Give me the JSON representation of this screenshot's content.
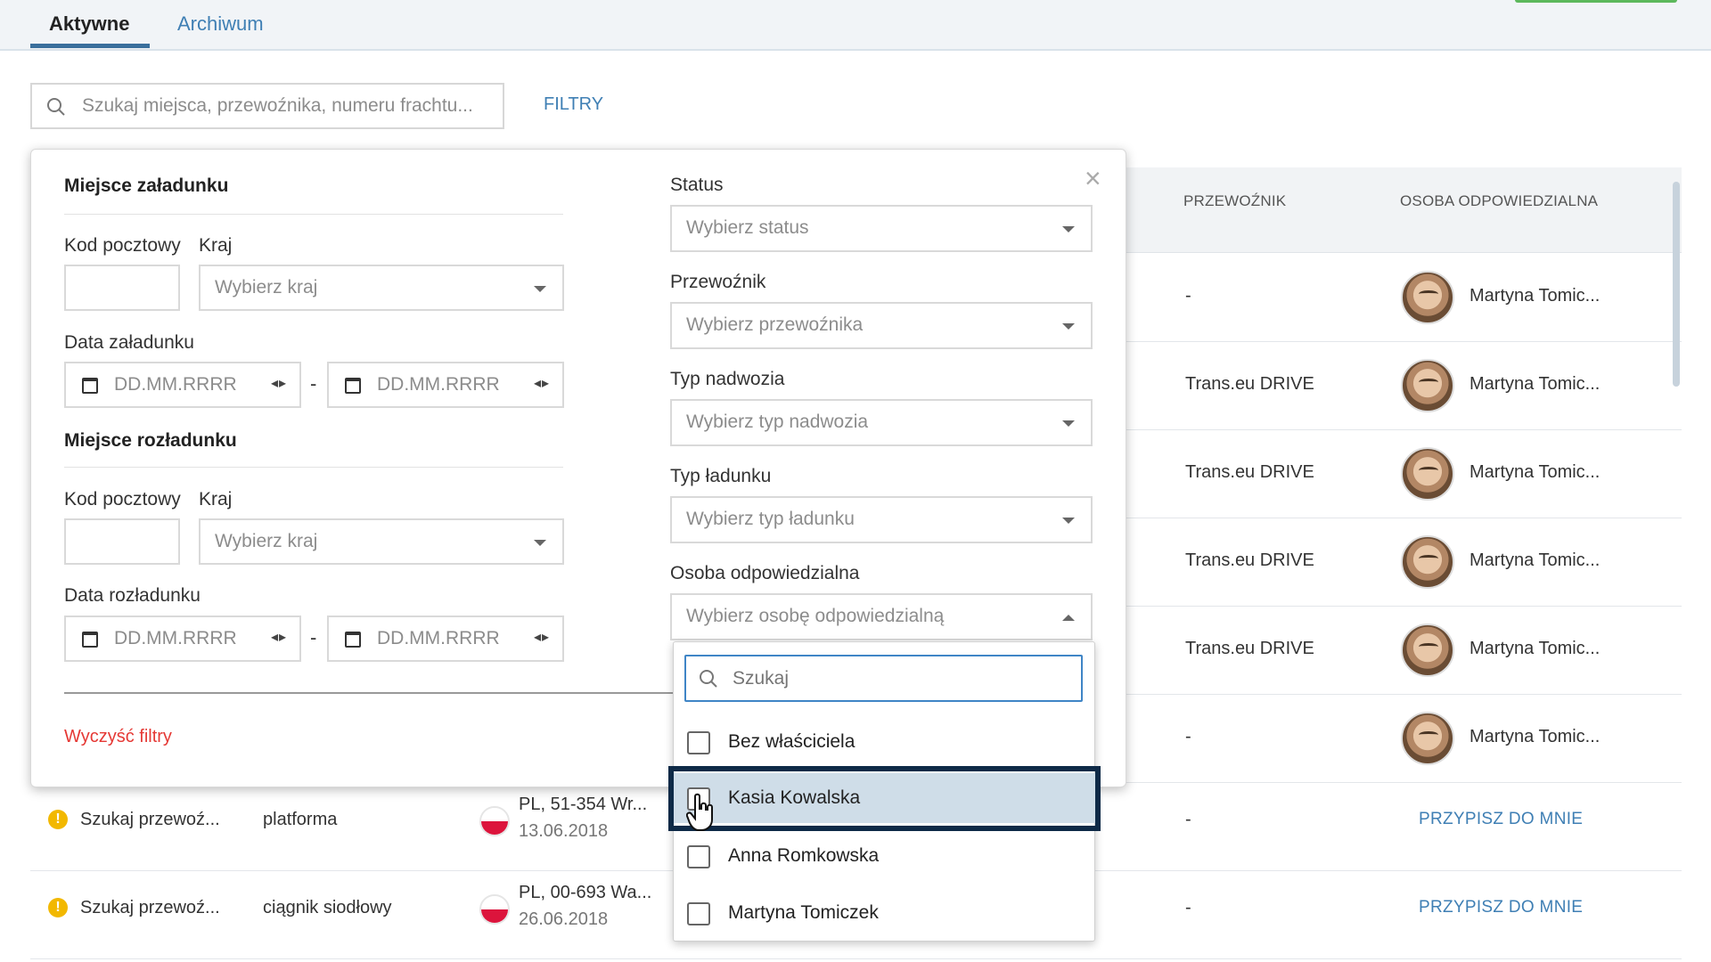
{
  "tabs": {
    "active": "Aktywne",
    "archive": "Archiwum"
  },
  "search": {
    "placeholder": "Szukaj miejsca, przewoźnika, numeru frachtu...",
    "filters_label": "FILTRY"
  },
  "table": {
    "headers": {
      "carrier": "PRZEWOŹNIK",
      "responsible": "OSOBA ODPOWIEDZIALNA"
    },
    "rows": [
      {
        "carrier": "-",
        "person": "Martyna Tomic..."
      },
      {
        "carrier": "Trans.eu DRIVE",
        "person": "Martyna Tomic..."
      },
      {
        "carrier": "Trans.eu DRIVE",
        "person": "Martyna Tomic..."
      },
      {
        "carrier": "Trans.eu DRIVE",
        "person": "Martyna Tomic..."
      },
      {
        "carrier": "Trans.eu DRIVE",
        "person": "Martyna Tomic..."
      },
      {
        "carrier": "-",
        "person": "Martyna Tomic..."
      },
      {
        "status": "Szukaj przewoź...",
        "body": "platforma",
        "place": "PL, 51-354 Wr...",
        "date": "13.06.2018",
        "carrier": "-",
        "assign": "PRZYPISZ DO MNIE"
      },
      {
        "status": "Szukaj przewoź...",
        "body": "ciągnik siodłowy",
        "place": "PL, 00-693 Wa...",
        "date": "26.06.2018",
        "carrier": "-",
        "assign": "PRZYPISZ DO MNIE"
      }
    ]
  },
  "filters": {
    "loading": {
      "title": "Miejsce załadunku",
      "postal_label": "Kod pocztowy",
      "country_label": "Kraj",
      "country_placeholder": "Wybierz kraj",
      "date_label": "Data załadunku",
      "date_placeholder": "DD.MM.RRRR"
    },
    "unloading": {
      "title": "Miejsce rozładunku",
      "postal_label": "Kod pocztowy",
      "country_label": "Kraj",
      "country_placeholder": "Wybierz kraj",
      "date_label": "Data rozładunku",
      "date_placeholder": "DD.MM.RRRR"
    },
    "status": {
      "label": "Status",
      "placeholder": "Wybierz status"
    },
    "carrier": {
      "label": "Przewoźnik",
      "placeholder": "Wybierz przewoźnika"
    },
    "body_type": {
      "label": "Typ nadwozia",
      "placeholder": "Wybierz typ nadwozia"
    },
    "load_type": {
      "label": "Typ ładunku",
      "placeholder": "Wybierz typ ładunku"
    },
    "responsible": {
      "label": "Osoba odpowiedzialna",
      "placeholder": "Wybierz osobę odpowiedzialną",
      "search_placeholder": "Szukaj",
      "options": [
        "Bez właściciela",
        "Kasia Kowalska",
        "Anna Romkowska",
        "Martyna Tomiczek"
      ],
      "highlighted": "Kasia Kowalska"
    },
    "clear_label": "Wyczyść filtry",
    "date_separator": "-"
  }
}
